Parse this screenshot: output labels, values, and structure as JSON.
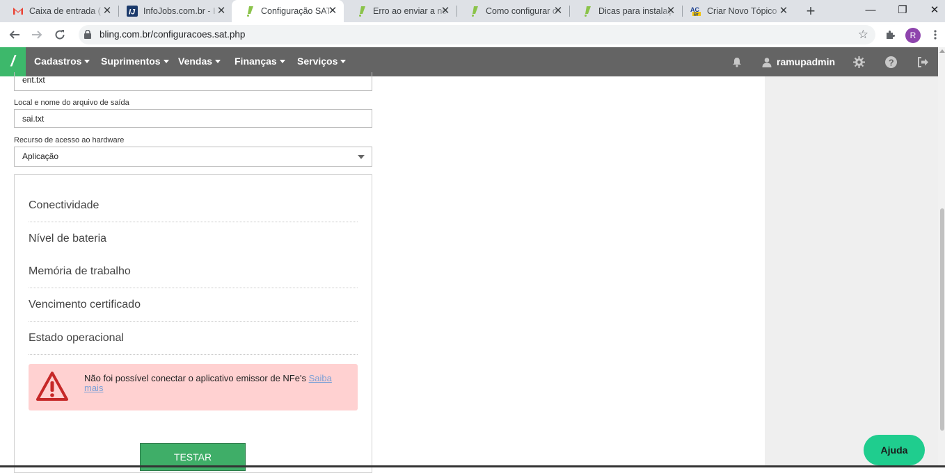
{
  "browser": {
    "tabs": [
      {
        "title": "Caixa de entrada (",
        "icon": "gmail-icon"
      },
      {
        "title": "InfoJobs.com.br - I",
        "icon": "infojobs-icon"
      },
      {
        "title": "Configuração SAT",
        "icon": "bling-icon",
        "active": true
      },
      {
        "title": "Erro ao enviar a no",
        "icon": "bling-icon"
      },
      {
        "title": "Como configurar o",
        "icon": "bling-icon"
      },
      {
        "title": "Dicas para instalaç",
        "icon": "bling-icon"
      },
      {
        "title": "Criar Novo Tópico",
        "icon": "acbr-icon"
      }
    ],
    "url": "bling.com.br/configuracoes.sat.php",
    "profile_initial": "R"
  },
  "nav": {
    "logo": "/",
    "menus": [
      "Cadastros",
      "Suprimentos",
      "Vendas",
      "Finanças",
      "Serviços"
    ],
    "username": "ramupadmin"
  },
  "form": {
    "input_file_value": "ent.txt",
    "output_label": "Local e nome do arquivo de saída",
    "output_value": "sai.txt",
    "hardware_label": "Recurso de acesso ao hardware",
    "hardware_value": "Aplicação"
  },
  "status_items": [
    "Conectividade",
    "Nível de bateria",
    "Memória de trabalho",
    "Vencimento certificado",
    "Estado operacional"
  ],
  "alert": {
    "message": "Não foi possível conectar o aplicativo emissor de NFe's",
    "link": "Saiba mais"
  },
  "test_button": "TESTAR",
  "help_button": "Ajuda",
  "colors": {
    "brand_green": "#3db86b",
    "nav_bg": "#646464",
    "alert_bg": "#ffd1d1",
    "help_green": "#1fcd8e"
  }
}
